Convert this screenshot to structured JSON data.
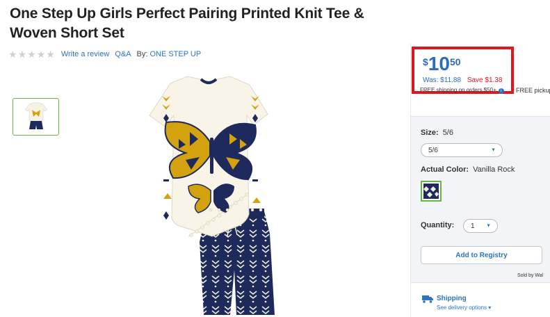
{
  "product": {
    "title": "One Step Up Girls Perfect Pairing Printed Knit Tee & Woven Short Set",
    "write_review": "Write a review",
    "qa": "Q&A",
    "by_label": "By:",
    "brand": "ONE STEP UP"
  },
  "rating": {
    "stars": 0,
    "max": 5
  },
  "price": {
    "symbol": "$",
    "whole": "10",
    "cents": "50",
    "was": "Was: $11.88",
    "save": "Save $1.38"
  },
  "shipping_note": "FREE shipping on orders $50+",
  "pickup_note": "FREE pickup",
  "options": {
    "size_label": "Size:",
    "size_value": "5/6",
    "size_selected": "5/6",
    "color_label": "Actual Color:",
    "color_value": "Vanilla Rock",
    "quantity_label": "Quantity:",
    "quantity_value": "1",
    "registry_button": "Add to Registry",
    "sold_by": "Sold by Wal"
  },
  "delivery": {
    "title": "Shipping",
    "link": "See delivery options ▾"
  },
  "colors": {
    "accent_blue": "#2a75c4",
    "price_blue": "#2a6ebb",
    "highlight_red": "#e0161e",
    "select_green": "#67b346",
    "navy": "#1e2a5c",
    "gold": "#d4a20e"
  }
}
